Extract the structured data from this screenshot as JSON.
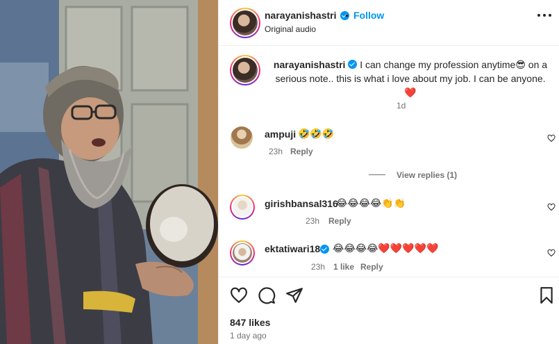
{
  "post": {
    "username": "narayanishastri",
    "follow_label": "Follow",
    "separator": "•",
    "audio": "Original audio"
  },
  "caption": {
    "username": "narayanishastri",
    "text": "I can change my profession anytime😎 on a serious note.. this is what i love about my job. I can be anyone. ❤️",
    "age": "1d"
  },
  "comments": [
    {
      "username": "ampuji",
      "text": "🤣🤣🤣",
      "time": "23h",
      "reply_label": "Reply",
      "view_replies": "View replies (1)"
    },
    {
      "username": "girishbansal316",
      "text": "😂😂😂😂👏👏",
      "time": "23h",
      "reply_label": "Reply"
    },
    {
      "username": "ektatiwari18",
      "text": "😂😂😂😂❤️❤️❤️❤️❤️",
      "time": "23h",
      "likes": "1 like",
      "reply_label": "Reply"
    }
  ],
  "footer": {
    "likes": "847 likes",
    "time_ago": "1 day ago"
  },
  "colors": {
    "accent": "#0095f6",
    "text": "#262626",
    "muted": "#737373",
    "divider": "#efefef"
  }
}
